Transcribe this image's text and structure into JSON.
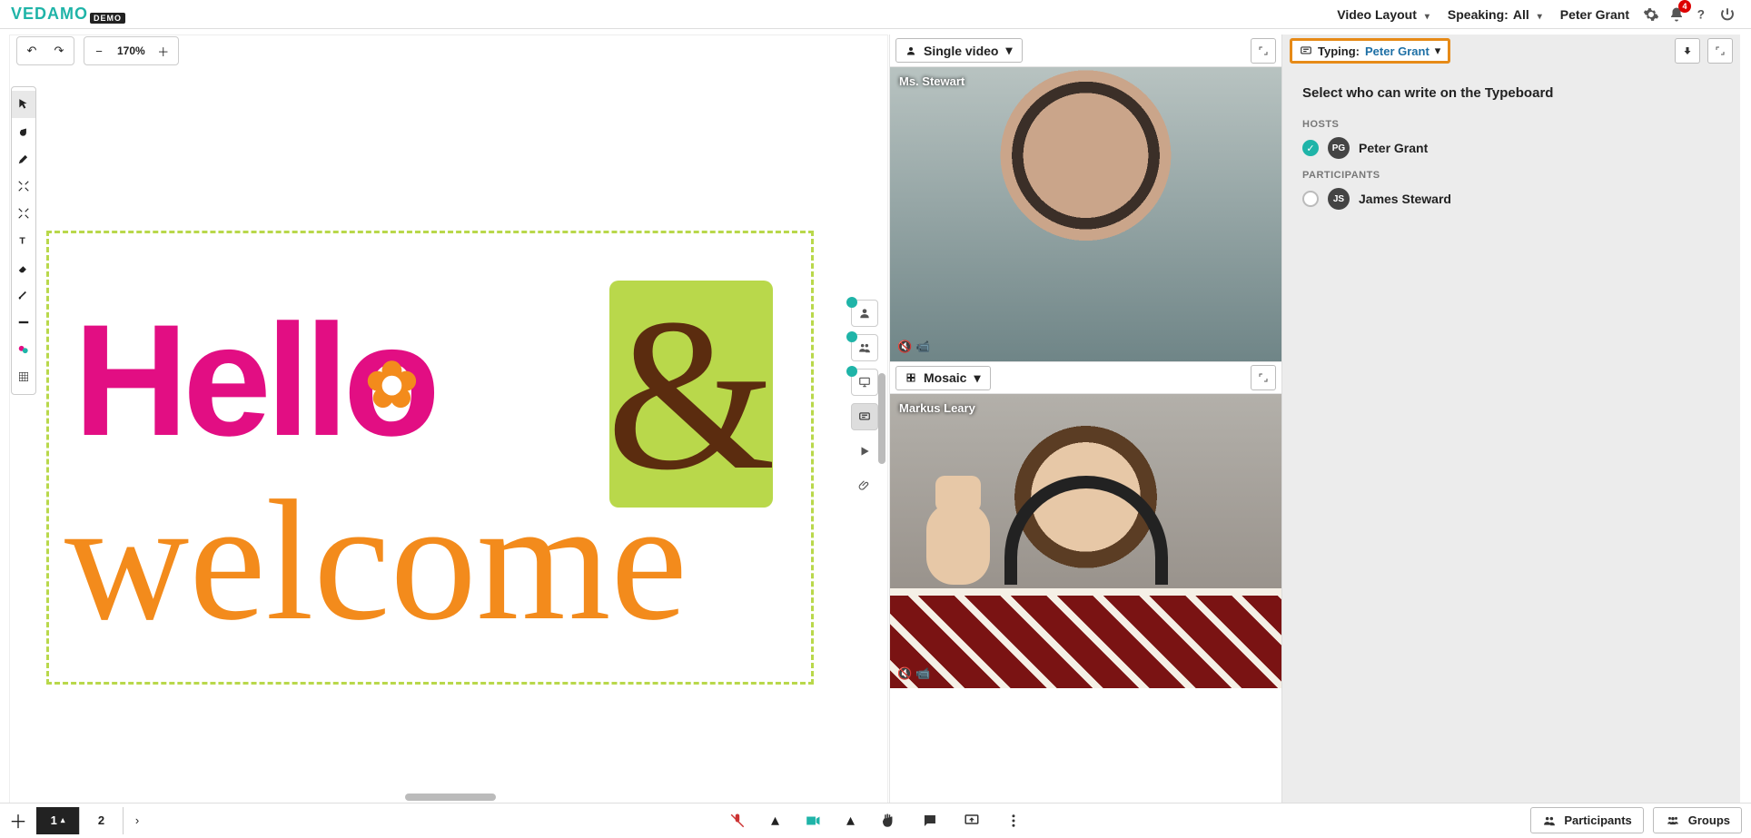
{
  "brand": {
    "name": "VEDAMO",
    "tag": "DEMO"
  },
  "topbar": {
    "video_layout": "Video Layout",
    "speaking_label": "Speaking:",
    "speaking_value": "All",
    "user": "Peter Grant",
    "notifications": "4"
  },
  "zoom": {
    "percent": "170%"
  },
  "whiteboard": {
    "hello": "Hello",
    "amp": "&",
    "welcome": "welcome"
  },
  "video": {
    "single_label": "Single video",
    "mosaic_label": "Mosaic",
    "tile1_name": "Ms. Stewart",
    "tile2_name": "Markus Leary"
  },
  "typeboard": {
    "typing_label": "Typing:",
    "typing_who": "Peter Grant",
    "heading": "Select who can write on the Typeboard",
    "hosts_label": "HOSTS",
    "participants_label": "PARTICIPANTS",
    "host_name": "Peter Grant",
    "host_initials": "PG",
    "participant_name": "James Steward",
    "participant_initials": "JS"
  },
  "pages": {
    "p1": "1",
    "p2": "2"
  },
  "bottom": {
    "participants": "Participants",
    "groups": "Groups"
  }
}
